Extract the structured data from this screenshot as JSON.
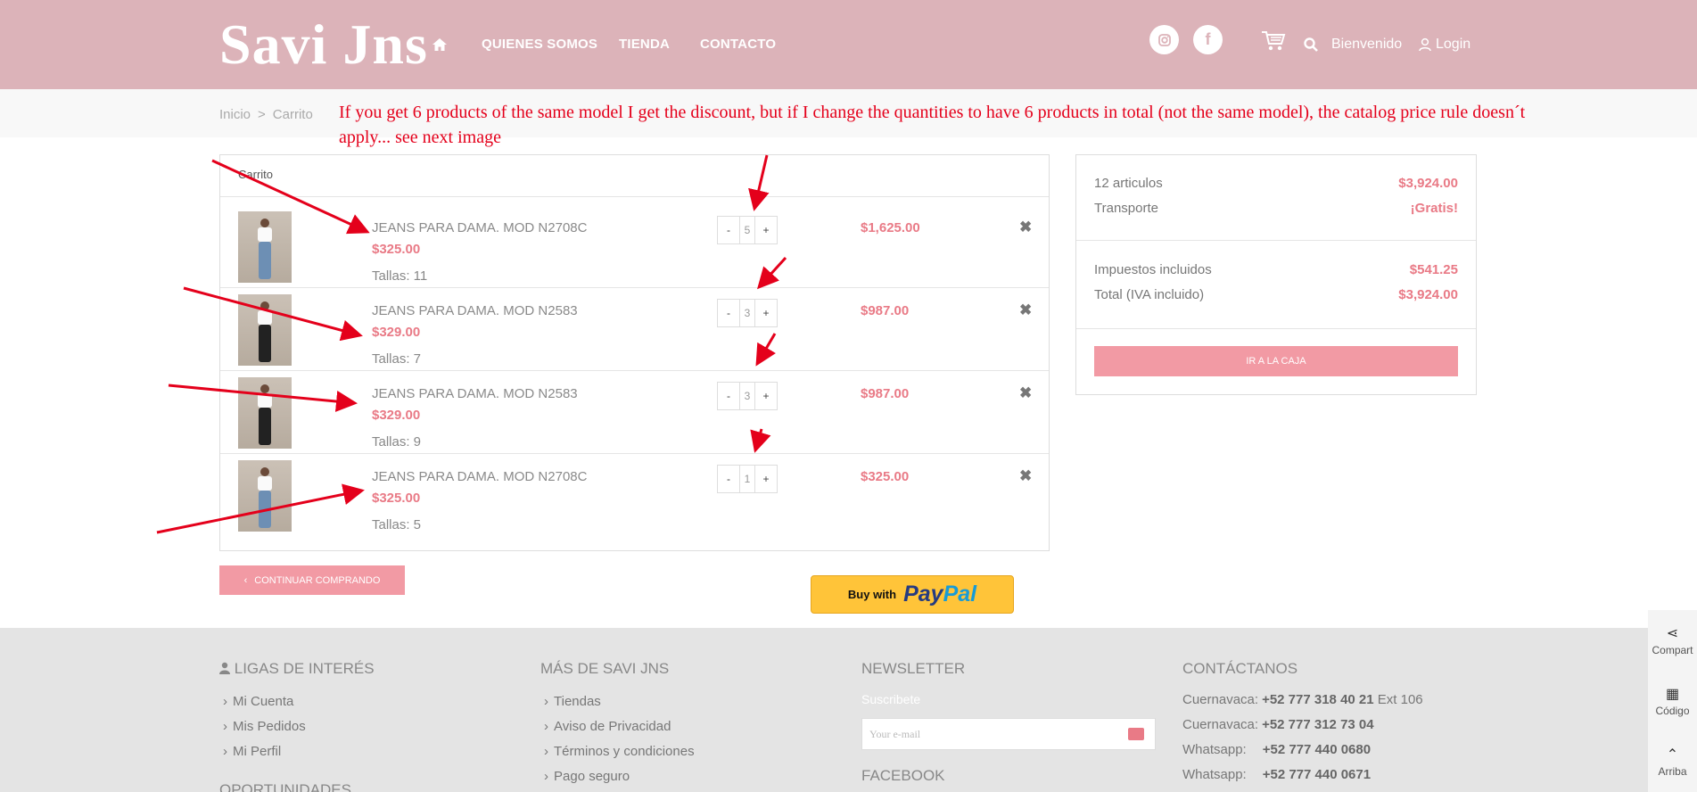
{
  "header": {
    "logo": "Savi Jns",
    "nav": [
      "QUIENES SOMOS",
      "TIENDA",
      "CONTACTO"
    ],
    "social": [
      "instagram-icon",
      "facebook-icon"
    ],
    "facebook_glyph": "f",
    "welcome": "Bienvenido",
    "login": "Login"
  },
  "breadcrumb": {
    "home": "Inicio",
    "separator": ">",
    "current": "Carrito"
  },
  "annotation": "If you get 6 products of the same model I get the discount, but if I change the quantities to have 6 products in total (not the same model), the catalog price rule doesn´t apply... see next image",
  "cart": {
    "title": "Carrito",
    "items": [
      {
        "name": "JEANS PARA DAMA. MOD N2708C",
        "price": "$325.00",
        "size": "Tallas: 11",
        "qty": "5",
        "total": "$1,625.00",
        "jeans": "blue"
      },
      {
        "name": "JEANS PARA DAMA. MOD N2583",
        "price": "$329.00",
        "size": "Tallas: 7",
        "qty": "3",
        "total": "$987.00",
        "jeans": "black"
      },
      {
        "name": "JEANS PARA DAMA. MOD N2583",
        "price": "$329.00",
        "size": "Tallas: 9",
        "qty": "3",
        "total": "$987.00",
        "jeans": "black"
      },
      {
        "name": "JEANS PARA DAMA. MOD N2708C",
        "price": "$325.00",
        "size": "Tallas: 5",
        "qty": "1",
        "total": "$325.00",
        "jeans": "blue"
      }
    ],
    "minus": "-",
    "plus": "+",
    "remove": "✖",
    "continue": "CONTINUAR COMPRANDO",
    "paypal_prefix": "Buy with",
    "paypal_a": "Pay",
    "paypal_b": "Pal"
  },
  "summary": {
    "items_label": "12 articulos",
    "items_value": "$3,924.00",
    "shipping_label": "Transporte",
    "shipping_value": "¡Gratis!",
    "tax_label": "Impuestos incluidos",
    "tax_value": "$541.25",
    "total_label": "Total (IVA incluido)",
    "total_value": "$3,924.00",
    "checkout": "IR A LA CAJA"
  },
  "footer": {
    "col1_title": "LIGAS DE INTERÉS",
    "col1_links": [
      "Mi Cuenta",
      "Mis Pedidos",
      "Mi Perfil"
    ],
    "col1_next": "OPORTUNIDADES",
    "col2_title": "MÁS DE SAVI JNS",
    "col2_links": [
      "Tiendas",
      "Aviso de Privacidad",
      "Términos y condiciones",
      "Pago seguro"
    ],
    "col3_title": "NEWSLETTER",
    "newsletter_label": "Suscribete",
    "newsletter_placeholder": "Your e-mail",
    "col3_next": "FACEBOOK",
    "col4_title": "CONTÁCTANOS",
    "contacts": [
      {
        "label": "Cuernavaca:",
        "value": "+52 777 318 40 21",
        "extra": " Ext 106"
      },
      {
        "label": "Cuernavaca:",
        "value": "+52 777 312 73 04",
        "extra": ""
      },
      {
        "label": "Whatsapp:",
        "value": "+52 777 440 0680",
        "extra": ""
      },
      {
        "label": "Whatsapp:",
        "value": "+52 777 440 0671",
        "extra": ""
      }
    ]
  },
  "side": {
    "share": "Compart",
    "code": "Código",
    "top": "Arriba"
  },
  "colors": {
    "header": "#dcb3b9",
    "accent": "#e97a86",
    "button": "#f29aa4",
    "annotation": "#e4001b",
    "paypal": "#ffc439"
  }
}
